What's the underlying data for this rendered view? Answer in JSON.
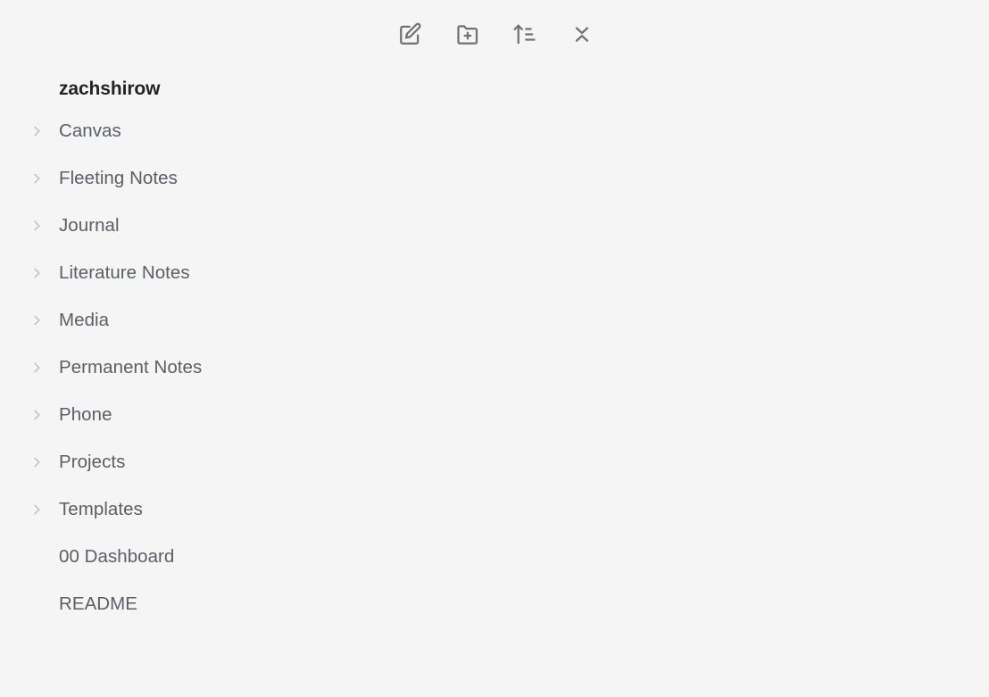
{
  "toolbar": {
    "actions": [
      {
        "name": "new-note-icon",
        "label": "New note"
      },
      {
        "name": "new-folder-icon",
        "label": "New folder"
      },
      {
        "name": "sort-order-icon",
        "label": "Change sort order"
      },
      {
        "name": "collapse-all-icon",
        "label": "Collapse all"
      }
    ]
  },
  "vault": {
    "title": "zachshirow"
  },
  "tree": {
    "items": [
      {
        "label": "Canvas",
        "type": "folder",
        "expanded": false
      },
      {
        "label": "Fleeting Notes",
        "type": "folder",
        "expanded": false
      },
      {
        "label": "Journal",
        "type": "folder",
        "expanded": false
      },
      {
        "label": "Literature Notes",
        "type": "folder",
        "expanded": false
      },
      {
        "label": "Media",
        "type": "folder",
        "expanded": false
      },
      {
        "label": "Permanent Notes",
        "type": "folder",
        "expanded": false
      },
      {
        "label": "Phone",
        "type": "folder",
        "expanded": false
      },
      {
        "label": "Projects",
        "type": "folder",
        "expanded": false
      },
      {
        "label": "Templates",
        "type": "folder",
        "expanded": false
      },
      {
        "label": "00 Dashboard",
        "type": "file"
      },
      {
        "label": "README",
        "type": "file"
      }
    ]
  },
  "colors": {
    "background": "#f5f5f5",
    "title_text": "#222326",
    "item_text": "#5a5f66",
    "icon": "#6e7276",
    "chevron": "#bdbdbd"
  }
}
